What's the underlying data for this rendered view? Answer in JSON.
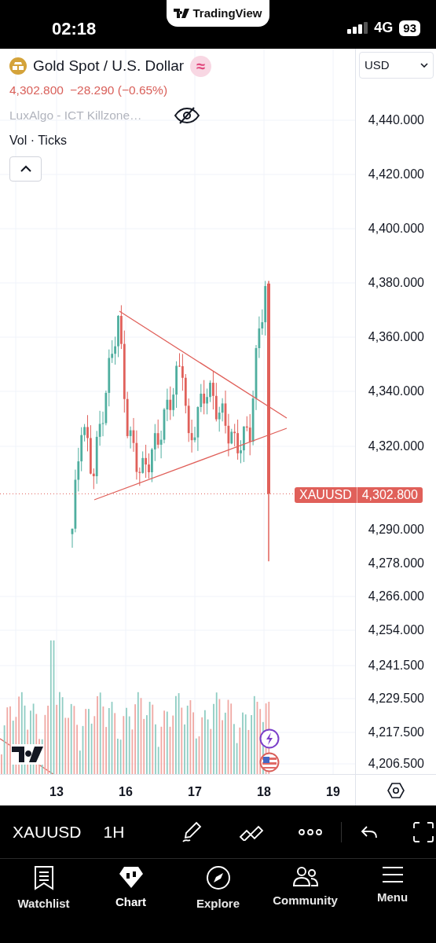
{
  "status_bar": {
    "time": "02:18",
    "app_pill": "TradingView",
    "network": "4G",
    "battery": "93"
  },
  "legend": {
    "symbol_title": "Gold Spot / U.S. Dollar",
    "symbol_badge": "≈",
    "price": "4,302.800",
    "change": "−28.290 (−0.65%)",
    "indicator": "LuxAlgo - ICT Killzone…",
    "indicator_hidden": true,
    "volume_label": "Vol · Ticks"
  },
  "currency": "USD",
  "price_axis": [
    "4,440.000",
    "4,420.000",
    "4,400.000",
    "4,380.000",
    "4,360.000",
    "4,340.000",
    "4,320.000",
    "4,290.000",
    "4,278.000",
    "4,266.000",
    "4,254.000",
    "4,241.500",
    "4,229.500",
    "4,217.500",
    "4,206.500"
  ],
  "last_price": {
    "symbol": "XAUUSD",
    "price": "4,302.800"
  },
  "time_axis": [
    "13",
    "16",
    "17",
    "18",
    "19"
  ],
  "toolbar": {
    "symbol": "XAUUSD",
    "interval": "1H"
  },
  "nav": [
    {
      "label": "Watchlist",
      "selected": false
    },
    {
      "label": "Chart",
      "selected": true
    },
    {
      "label": "Explore",
      "selected": false
    },
    {
      "label": "Community",
      "selected": false
    },
    {
      "label": "Menu",
      "selected": false
    }
  ]
}
